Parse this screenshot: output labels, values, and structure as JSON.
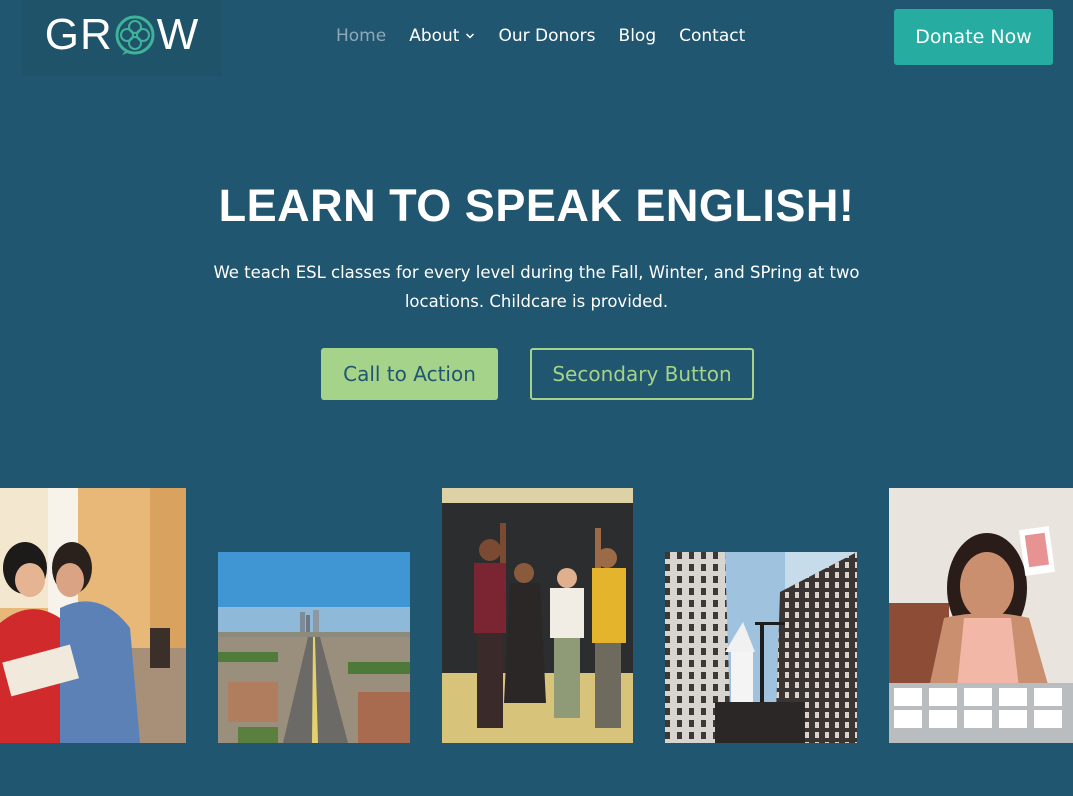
{
  "header": {
    "logo_text": "GROW",
    "nav": [
      {
        "label": "Home"
      },
      {
        "label": "About"
      },
      {
        "label": "Our Donors"
      },
      {
        "label": "Blog"
      },
      {
        "label": "Contact"
      }
    ],
    "donate_label": "Donate Now"
  },
  "hero": {
    "title": "LEARN TO SPEAK ENGLISH!",
    "subtitle_line1": "We teach ESL classes for every level during the Fall, Winter, and SPring at two",
    "subtitle_line2": "locations. Childcare is provided.",
    "cta_primary": "Call to Action",
    "cta_secondary": "Secondary Button"
  },
  "gallery": {
    "images": [
      {
        "icon": "students-reading-photo"
      },
      {
        "icon": "city-aerial-photo"
      },
      {
        "icon": "group-celebrating-photo"
      },
      {
        "icon": "city-buildings-photo"
      },
      {
        "icon": "teacher-with-cards-photo"
      }
    ]
  },
  "colors": {
    "background": "#215670",
    "donate": "#26aca0",
    "accent_green": "#a5d38a"
  }
}
